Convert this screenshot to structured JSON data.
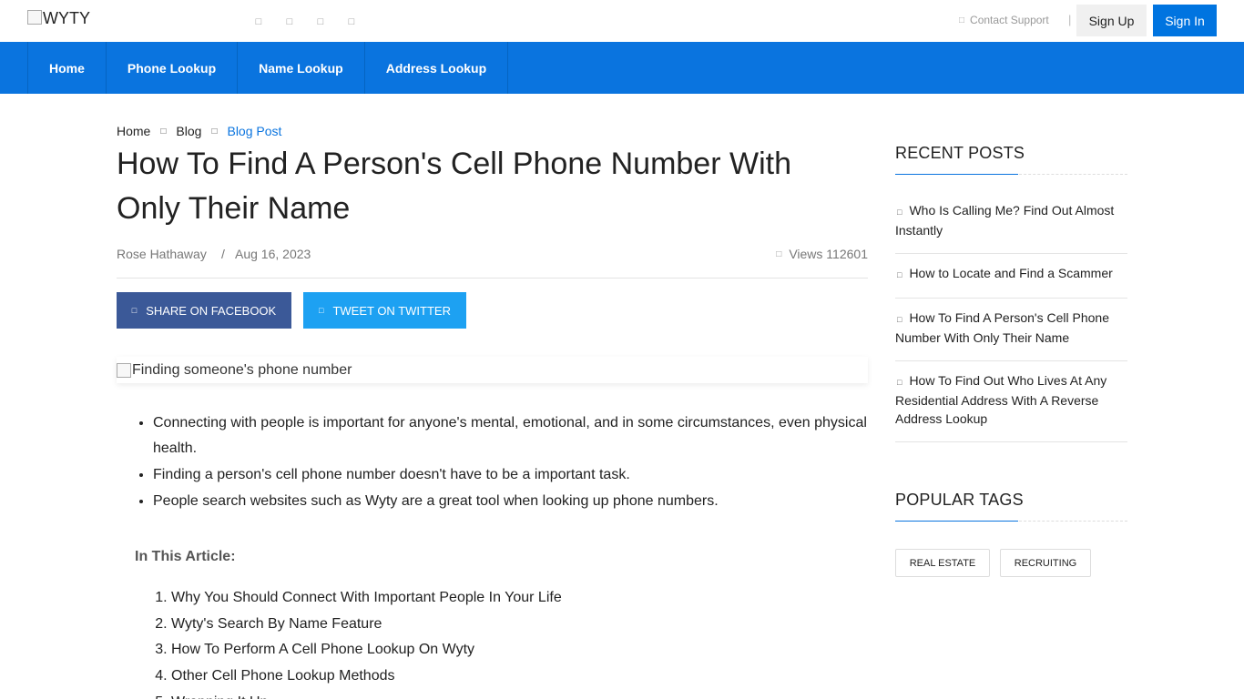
{
  "header": {
    "logo_text": "WYTY",
    "social_icons": [
      "facebook-icon",
      "twitter-icon",
      "instagram-icon",
      "linkedin-icon"
    ],
    "support_label": "Contact Support",
    "support_icon_glyph": "✉",
    "separator": "|",
    "signup_label": "Sign Up",
    "signin_label": "Sign In",
    "accent_color": "#0a74df"
  },
  "nav": {
    "items": [
      "Home",
      "Phone Lookup",
      "Name Lookup",
      "Address Lookup"
    ]
  },
  "breadcrumb": {
    "items": [
      "Home",
      "Blog",
      "Blog Post"
    ],
    "arrow_glyph": "›"
  },
  "article": {
    "title": "How To Find A Person's Cell Phone Number With Only Their Name",
    "author": "Rose Hathaway",
    "separator": "/",
    "date": "Aug 16, 2023",
    "views": "Views 112601",
    "share_facebook": "SHARE ON FACEBOOK",
    "share_twitter": "TWEET ON TWITTER",
    "image_alt": "Finding someone's phone number",
    "bullets": [
      "Connecting with people is important for anyone's mental, emotional, and in some circumstances, even physical health.",
      "Finding a person's cell phone number doesn't have to be a important task.",
      "People search websites such as Wyty are a great tool when looking up phone numbers."
    ],
    "toc_heading": "In This Article:",
    "toc": [
      "Why You Should Connect With Important People In Your Life",
      "Wyty's Search By Name Feature",
      "How To Perform A Cell Phone Lookup On Wyty",
      "Other Cell Phone Lookup Methods",
      "Wrapping It Up"
    ]
  },
  "sidebar": {
    "recent_heading": "RECENT POSTS",
    "recent_posts": [
      "Who Is Calling Me? Find Out Almost Instantly",
      "How to Locate and Find a Scammer",
      "How To Find A Person's Cell Phone Number With Only Their Name",
      "How To Find Out Who Lives At Any Residential Address With A Reverse Address Lookup"
    ],
    "tags_heading": "POPULAR TAGS",
    "tags": [
      "REAL ESTATE",
      "RECRUITING"
    ]
  }
}
